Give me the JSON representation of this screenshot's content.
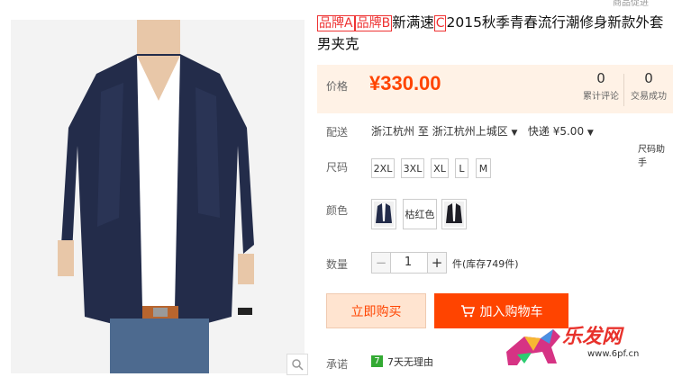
{
  "header": {
    "top_crop_text": "商品促进"
  },
  "product": {
    "brand_a": "品牌A",
    "brand_b": "品牌B",
    "title_mid": "新满速",
    "brand_c": "C",
    "title_end": "2015秋季青春流行潮修身新款外套男夹克"
  },
  "price": {
    "label": "价格",
    "value": "¥330.00"
  },
  "stats": [
    {
      "count": "0",
      "label": "累计评论"
    },
    {
      "count": "0",
      "label": "交易成功"
    }
  ],
  "delivery": {
    "label": "配送",
    "from": "浙江杭州",
    "to_word": "至",
    "to": "浙江杭州上城区",
    "method": "快递 ¥5.00",
    "size_helper": "尺码助手"
  },
  "size": {
    "label": "尺码",
    "options": [
      "2XL",
      "3XL",
      "XL",
      "L",
      "M"
    ]
  },
  "color": {
    "label": "颜色",
    "option_text": "枯红色"
  },
  "quantity": {
    "label": "数量",
    "minus": "−",
    "value": "1",
    "plus": "+",
    "stock": "件(库存749件)"
  },
  "actions": {
    "buy_now": "立即购买",
    "add_cart": "加入购物车"
  },
  "promise": {
    "label": "承诺",
    "badge": "7",
    "text": "7天无理由"
  },
  "watermark": {
    "text": "乐发网",
    "url": "www.6pf.cn"
  },
  "colors": {
    "accent": "#ff4400",
    "price_bg": "#fff2e6",
    "brand_box": "#ee3333",
    "jacket": "#232c4a"
  }
}
